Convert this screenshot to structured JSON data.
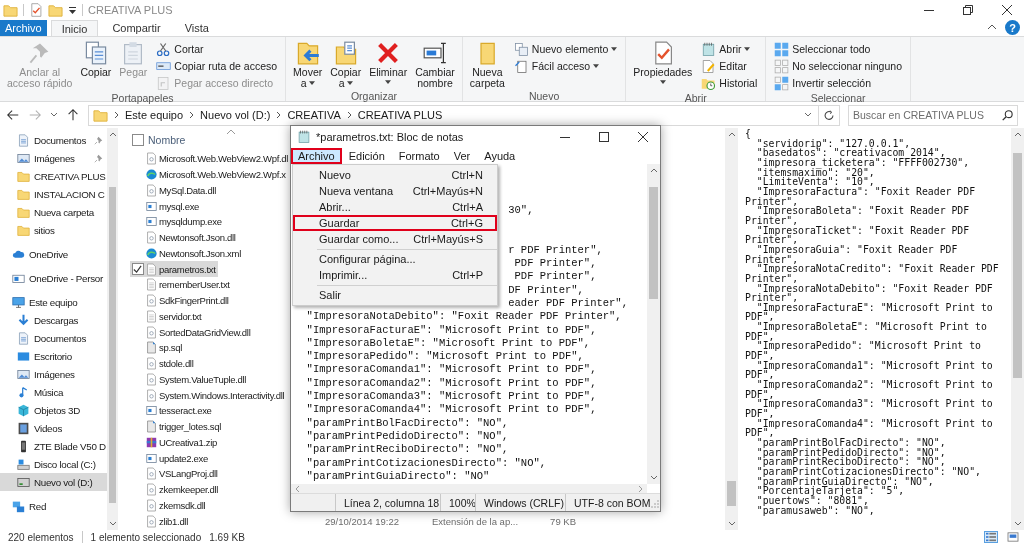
{
  "window": {
    "title": "CREATIVA PLUS",
    "help": "?"
  },
  "ribbon_tabs": [
    {
      "label": "Archivo",
      "kind": "file",
      "selected": false
    },
    {
      "label": "Inicio",
      "kind": "tab",
      "selected": true
    },
    {
      "label": "Compartir",
      "kind": "tab",
      "selected": false
    },
    {
      "label": "Vista",
      "kind": "tab",
      "selected": false
    }
  ],
  "ribbon_groups": [
    {
      "label": "Portapapeles",
      "items": [
        {
          "label": "Anclar al\nacceso rápido",
          "kind": "large",
          "disabled": true,
          "dropdown": false
        },
        {
          "label": "Copiar",
          "kind": "large",
          "disabled": false,
          "dropdown": false
        },
        {
          "label": "Pegar",
          "kind": "large",
          "disabled": true,
          "dropdown": false
        },
        {
          "label": "Cortar",
          "kind": "small",
          "disabled": false,
          "dropdown": false
        },
        {
          "label": "Copiar ruta de acceso",
          "kind": "small",
          "disabled": false,
          "dropdown": false
        },
        {
          "label": "Pegar acceso directo",
          "kind": "small",
          "disabled": true,
          "dropdown": false
        }
      ]
    },
    {
      "label": "Organizar",
      "items": [
        {
          "label": "Mover\na",
          "kind": "large",
          "disabled": false,
          "dropdown": true
        },
        {
          "label": "Copiar\na",
          "kind": "large",
          "disabled": false,
          "dropdown": true
        },
        {
          "label": "Eliminar",
          "kind": "large",
          "disabled": false,
          "dropdown": true
        },
        {
          "label": "Cambiar\nnombre",
          "kind": "large",
          "disabled": false,
          "dropdown": false
        }
      ]
    },
    {
      "label": "Nuevo",
      "items": [
        {
          "label": "Nueva\ncarpeta",
          "kind": "large",
          "disabled": false,
          "dropdown": false
        },
        {
          "label": "Nuevo elemento",
          "kind": "small",
          "disabled": false,
          "dropdown": true
        },
        {
          "label": "Fácil acceso",
          "kind": "small",
          "disabled": false,
          "dropdown": true
        }
      ]
    },
    {
      "label": "Abrir",
      "items": [
        {
          "label": "Propiedades",
          "kind": "large",
          "disabled": false,
          "dropdown": true
        },
        {
          "label": "Abrir",
          "kind": "small",
          "disabled": false,
          "dropdown": true
        },
        {
          "label": "Editar",
          "kind": "small",
          "disabled": false,
          "dropdown": false
        },
        {
          "label": "Historial",
          "kind": "small",
          "disabled": false,
          "dropdown": false
        }
      ]
    },
    {
      "label": "Seleccionar",
      "items": [
        {
          "label": "Seleccionar todo",
          "kind": "small",
          "disabled": false,
          "dropdown": false
        },
        {
          "label": "No seleccionar ninguno",
          "kind": "small",
          "disabled": false,
          "dropdown": false
        },
        {
          "label": "Invertir selección",
          "kind": "small",
          "disabled": false,
          "dropdown": false
        }
      ]
    }
  ],
  "address": {
    "path": [
      "Este equipo",
      "Nuevo vol (D:)",
      "CREATIVA",
      "CREATIVA PLUS"
    ],
    "search_placeholder": "Buscar en CREATIVA PLUS"
  },
  "sidebar": {
    "quick_access": [
      {
        "label": "Documentos",
        "pinned": true,
        "selected": false
      },
      {
        "label": "Imágenes",
        "pinned": true,
        "selected": false
      },
      {
        "label": "CREATIVA PLUS",
        "selected": false
      },
      {
        "label": "INSTALACION C",
        "selected": false
      },
      {
        "label": "Nueva carpeta",
        "selected": false
      },
      {
        "label": "sitios",
        "selected": false
      }
    ],
    "items": [
      {
        "label": "OneDrive",
        "selected": false
      },
      {
        "label": "OneDrive - Persor",
        "selected": false
      },
      {
        "label": "Este equipo",
        "selected": false,
        "children": [
          {
            "label": "Descargas",
            "selected": false
          },
          {
            "label": "Documentos",
            "selected": false
          },
          {
            "label": "Escritorio",
            "selected": false
          },
          {
            "label": "Imágenes",
            "selected": false
          },
          {
            "label": "Música",
            "selected": false
          },
          {
            "label": "Objetos 3D",
            "selected": false
          },
          {
            "label": "Videos",
            "selected": false
          },
          {
            "label": "ZTE Blade V50 D",
            "selected": false
          },
          {
            "label": "Disco local (C:)",
            "selected": false
          },
          {
            "label": "Nuevo vol (D:)",
            "selected": true
          }
        ]
      },
      {
        "label": "Red",
        "selected": false
      }
    ]
  },
  "file_list": {
    "column": "Nombre",
    "select_all_checked": false,
    "files": [
      {
        "name": "Microsoft.Web.WebView2.Wpf.dl",
        "selected": false,
        "checked": false
      },
      {
        "name": "Microsoft.Web.WebView2.Wpf.x",
        "selected": false,
        "checked": false
      },
      {
        "name": "MySql.Data.dll",
        "selected": false,
        "checked": false
      },
      {
        "name": "mysql.exe",
        "selected": false,
        "checked": false
      },
      {
        "name": "mysqldump.exe",
        "selected": false,
        "checked": false
      },
      {
        "name": "Newtonsoft.Json.dll",
        "selected": false,
        "checked": false
      },
      {
        "name": "Newtonsoft.Json.xml",
        "selected": false,
        "checked": false
      },
      {
        "name": "parametros.txt",
        "selected": true,
        "checked": true
      },
      {
        "name": "rememberUser.txt",
        "selected": false,
        "checked": false
      },
      {
        "name": "SdkFingerPrint.dll",
        "selected": false,
        "checked": false
      },
      {
        "name": "servidor.txt",
        "selected": false,
        "checked": false
      },
      {
        "name": "SortedDataGridView.dll",
        "selected": false,
        "checked": false
      },
      {
        "name": "sp.sql",
        "selected": false,
        "checked": false
      },
      {
        "name": "stdole.dll",
        "selected": false,
        "checked": false
      },
      {
        "name": "System.ValueTuple.dll",
        "selected": false,
        "checked": false
      },
      {
        "name": "System.Windows.Interactivity.dll",
        "selected": false,
        "checked": false
      },
      {
        "name": "tesseract.exe",
        "selected": false,
        "checked": false
      },
      {
        "name": "trigger_lotes.sql",
        "selected": false,
        "checked": false
      },
      {
        "name": "UCreativa1.zip",
        "selected": false,
        "checked": false
      },
      {
        "name": "update2.exe",
        "selected": false,
        "checked": false
      },
      {
        "name": "VSLangProj.dll",
        "selected": false,
        "checked": false
      },
      {
        "name": "zkemkeeper.dll",
        "selected": false,
        "checked": false
      },
      {
        "name": "zkemsdk.dll",
        "selected": false,
        "checked": false
      },
      {
        "name": "zlib1.dll",
        "selected": false,
        "checked": false,
        "date": "29/10/2014 19:22",
        "type": "Extensión de la ap...",
        "size": "79 KB"
      }
    ]
  },
  "preview": {
    "lines": [
      "{",
      "  \"servidorip\": \"127.0.0.1\",",
      "  \"basedatos\": \"creativacom_2014\",",
      "  \"impresora_ticketera\": \"FFFF002730\",",
      "  \"itemsmaximo\": \"20\",",
      "  \"LimiteVenta\": \"10\",",
      "  \"ImpresoraFactura\": \"Foxit Reader PDF",
      "Printer\",",
      "  \"ImpresoraBoleta\": \"Foxit Reader PDF",
      "Printer\",",
      "  \"ImpresoraTicket\": \"Foxit Reader PDF",
      "Printer\",",
      "  \"ImpresoraGuia\": \"Foxit Reader PDF",
      "Printer\",",
      "  \"ImpresoraNotaCredito\": \"Foxit Reader PDF",
      "Printer\",",
      "  \"ImpresoraNotaDebito\": \"Foxit Reader PDF",
      "Printer\",",
      "  \"ImpresoraFacturaE\": \"Microsoft Print to",
      "PDF\",",
      "  \"ImpresoraBoletaE\": \"Microsoft Print to",
      "PDF\",",
      "  \"ImpresoraPedido\": \"Microsoft Print to",
      "PDF\",",
      "  \"ImpresoraComanda1\": \"Microsoft Print to",
      "PDF\",",
      "  \"ImpresoraComanda2\": \"Microsoft Print to",
      "PDF\",",
      "  \"ImpresoraComanda3\": \"Microsoft Print to",
      "PDF\",",
      "  \"ImpresoraComanda4\": \"Microsoft Print to",
      "PDF\",",
      "  \"paramPrintBolFacDirecto\": \"NO\",",
      "  \"paramPrintPedidoDirecto\": \"NO\",",
      "  \"paramPrintReciboDirecto\": \"NO\",",
      "  \"paramPrintCotizacionesDirecto\": \"NO\",",
      "  \"paramPrintGuiaDirecto\": \"NO\",",
      "  \"PorcentajeTarjeta\": \"5\",",
      "  \"puertows\": \"8081\",",
      "  \"paramusaweb\": \"NO\","
    ]
  },
  "status_bar": {
    "items": [
      "220 elementos",
      "1 elemento seleccionado",
      "1.69 KB"
    ],
    "views": [
      {
        "selected": true
      },
      {
        "selected": false
      }
    ]
  },
  "notepad": {
    "title": "*parametros.txt: Bloc de notas",
    "menus": [
      {
        "label": "Archivo",
        "selected": true,
        "highlighted": true
      },
      {
        "label": "Edición",
        "selected": false,
        "highlighted": false
      },
      {
        "label": "Formato",
        "selected": false,
        "highlighted": false
      },
      {
        "label": "Ver",
        "selected": false,
        "highlighted": false
      },
      {
        "label": "Ayuda",
        "selected": false,
        "highlighted": false
      }
    ],
    "menu_items": [
      {
        "kind": "item",
        "label": "Nuevo",
        "shortcut": "Ctrl+N",
        "highlighted": false
      },
      {
        "kind": "item",
        "label": "Nueva ventana",
        "shortcut": "Ctrl+Mayús+N",
        "highlighted": false
      },
      {
        "kind": "item",
        "label": "Abrir...",
        "shortcut": "Ctrl+A",
        "highlighted": false
      },
      {
        "kind": "item",
        "label": "Guardar",
        "shortcut": "Ctrl+G",
        "highlighted": true
      },
      {
        "kind": "item",
        "label": "Guardar como...",
        "shortcut": "Ctrl+Mayús+S",
        "highlighted": false
      },
      {
        "kind": "separator"
      },
      {
        "kind": "item",
        "label": "Configurar página...",
        "highlighted": false
      },
      {
        "kind": "item",
        "label": "Imprimir...",
        "shortcut": "Ctrl+P",
        "highlighted": false
      },
      {
        "kind": "separator"
      },
      {
        "kind": "item",
        "label": "Salir",
        "highlighted": false
      }
    ],
    "lines": [
      "30\",",
      "r PDF Printer\",",
      "PDF Printer\",",
      "PDF Printer\",",
      "DF Printer\",",
      "eader PDF Printer\",",
      "  \"ImpresoraNotaDebito\": \"Foxit Reader PDF Printer\",",
      "  \"ImpresoraFacturaE\": \"Microsoft Print to PDF\",",
      "  \"ImpresoraBoletaE\": \"Microsoft Print to PDF\",",
      "  \"ImpresoraPedido\": \"Microsoft Print to PDF\",",
      "  \"ImpresoraComanda1\": \"Microsoft Print to PDF\",",
      "  \"ImpresoraComanda2\": \"Microsoft Print to PDF\",",
      "  \"ImpresoraComanda3\": \"Microsoft Print to PDF\",",
      "  \"ImpresoraComanda4\": \"Microsoft Print to PDF\",",
      "  \"paramPrintBolFacDirecto\": \"NO\",",
      "  \"paramPrintPedidoDirecto\": \"NO\",",
      "  \"paramPrintReciboDirecto\": \"NO\",",
      "  \"paramPrintCotizacionesDirecto\": \"NO\",",
      "  \"paramPrintGuiaDirecto\": \"NO\""
    ],
    "status": [
      "Línea 2, columna 18",
      "100%",
      "Windows (CRLF)",
      "UTF-8 con BOM"
    ]
  }
}
